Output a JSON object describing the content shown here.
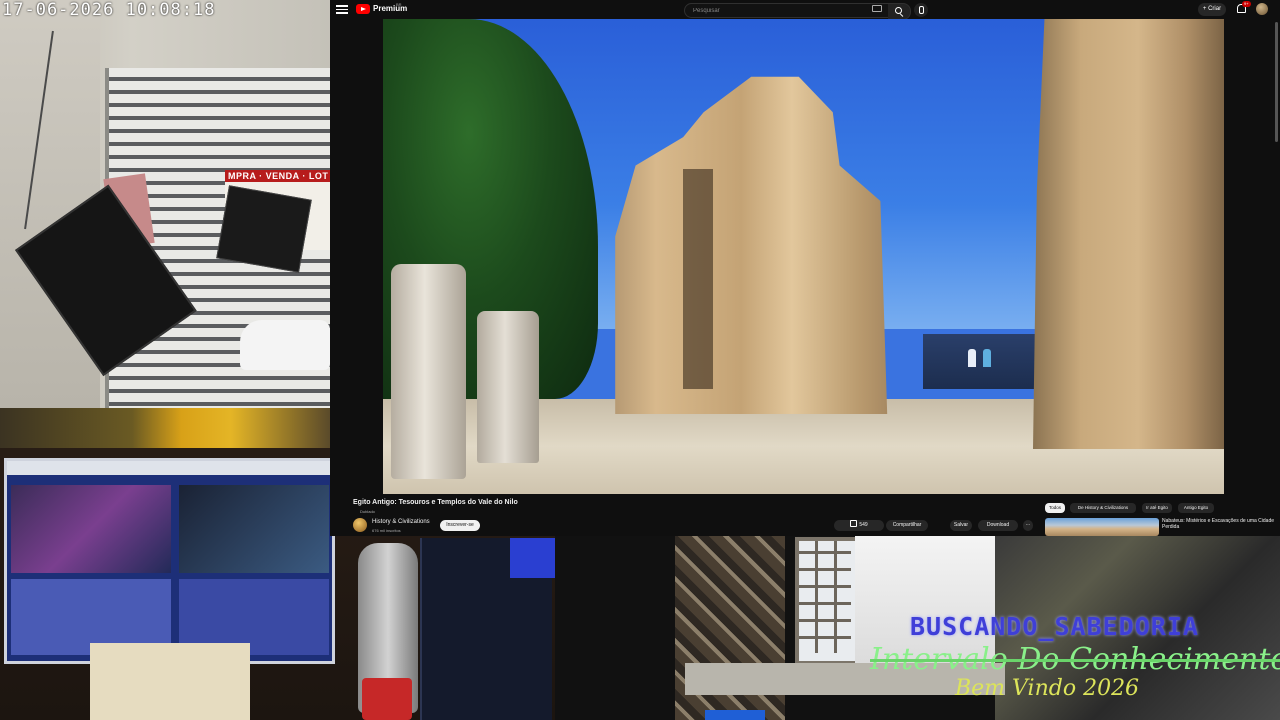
{
  "overlay": {
    "timestamp": "17-06-2026 10:08:18",
    "line1": "BUSCANDO_SABEDORIA",
    "line2": "Intervalo Do Conhecimento",
    "line3": "Bem Vindo 2026"
  },
  "camera": {
    "sign_text": "MPRA · VENDA · LOT"
  },
  "youtube": {
    "brand": "Premium",
    "country_code": "BR",
    "search": {
      "placeholder": "Pesquisar",
      "value": ""
    },
    "create_label": "+ Criar",
    "notification_count": "9+",
    "video": {
      "title": "Egito Antigo: Tesouros e Templos do Vale do Nilo",
      "dub_label": "Dublado",
      "channel": "History & Civilizations",
      "subscribers": "676 mil inscritos",
      "subscribe_label": "Inscrever-se",
      "likes": "549",
      "share_label": "Compartilhar",
      "save_label": "Salvar",
      "download_label": "Download",
      "more_label": "···"
    },
    "chips": [
      {
        "label": "Todos",
        "active": true
      },
      {
        "label": "De History & Civilizations",
        "active": false
      },
      {
        "label": "Ir até Egito",
        "active": false
      },
      {
        "label": "Antigo Egito",
        "active": false
      }
    ],
    "recommendation": {
      "title": "Nabateus: Mistérios e Escavações de uma Cidade Perdida"
    }
  },
  "colors": {
    "youtube_bg": "#0f0f0f",
    "youtube_red": "#ff0000",
    "overlay_blue": "#3f3fd8",
    "overlay_green": "#8af08a",
    "overlay_yellow": "#dce45a"
  }
}
